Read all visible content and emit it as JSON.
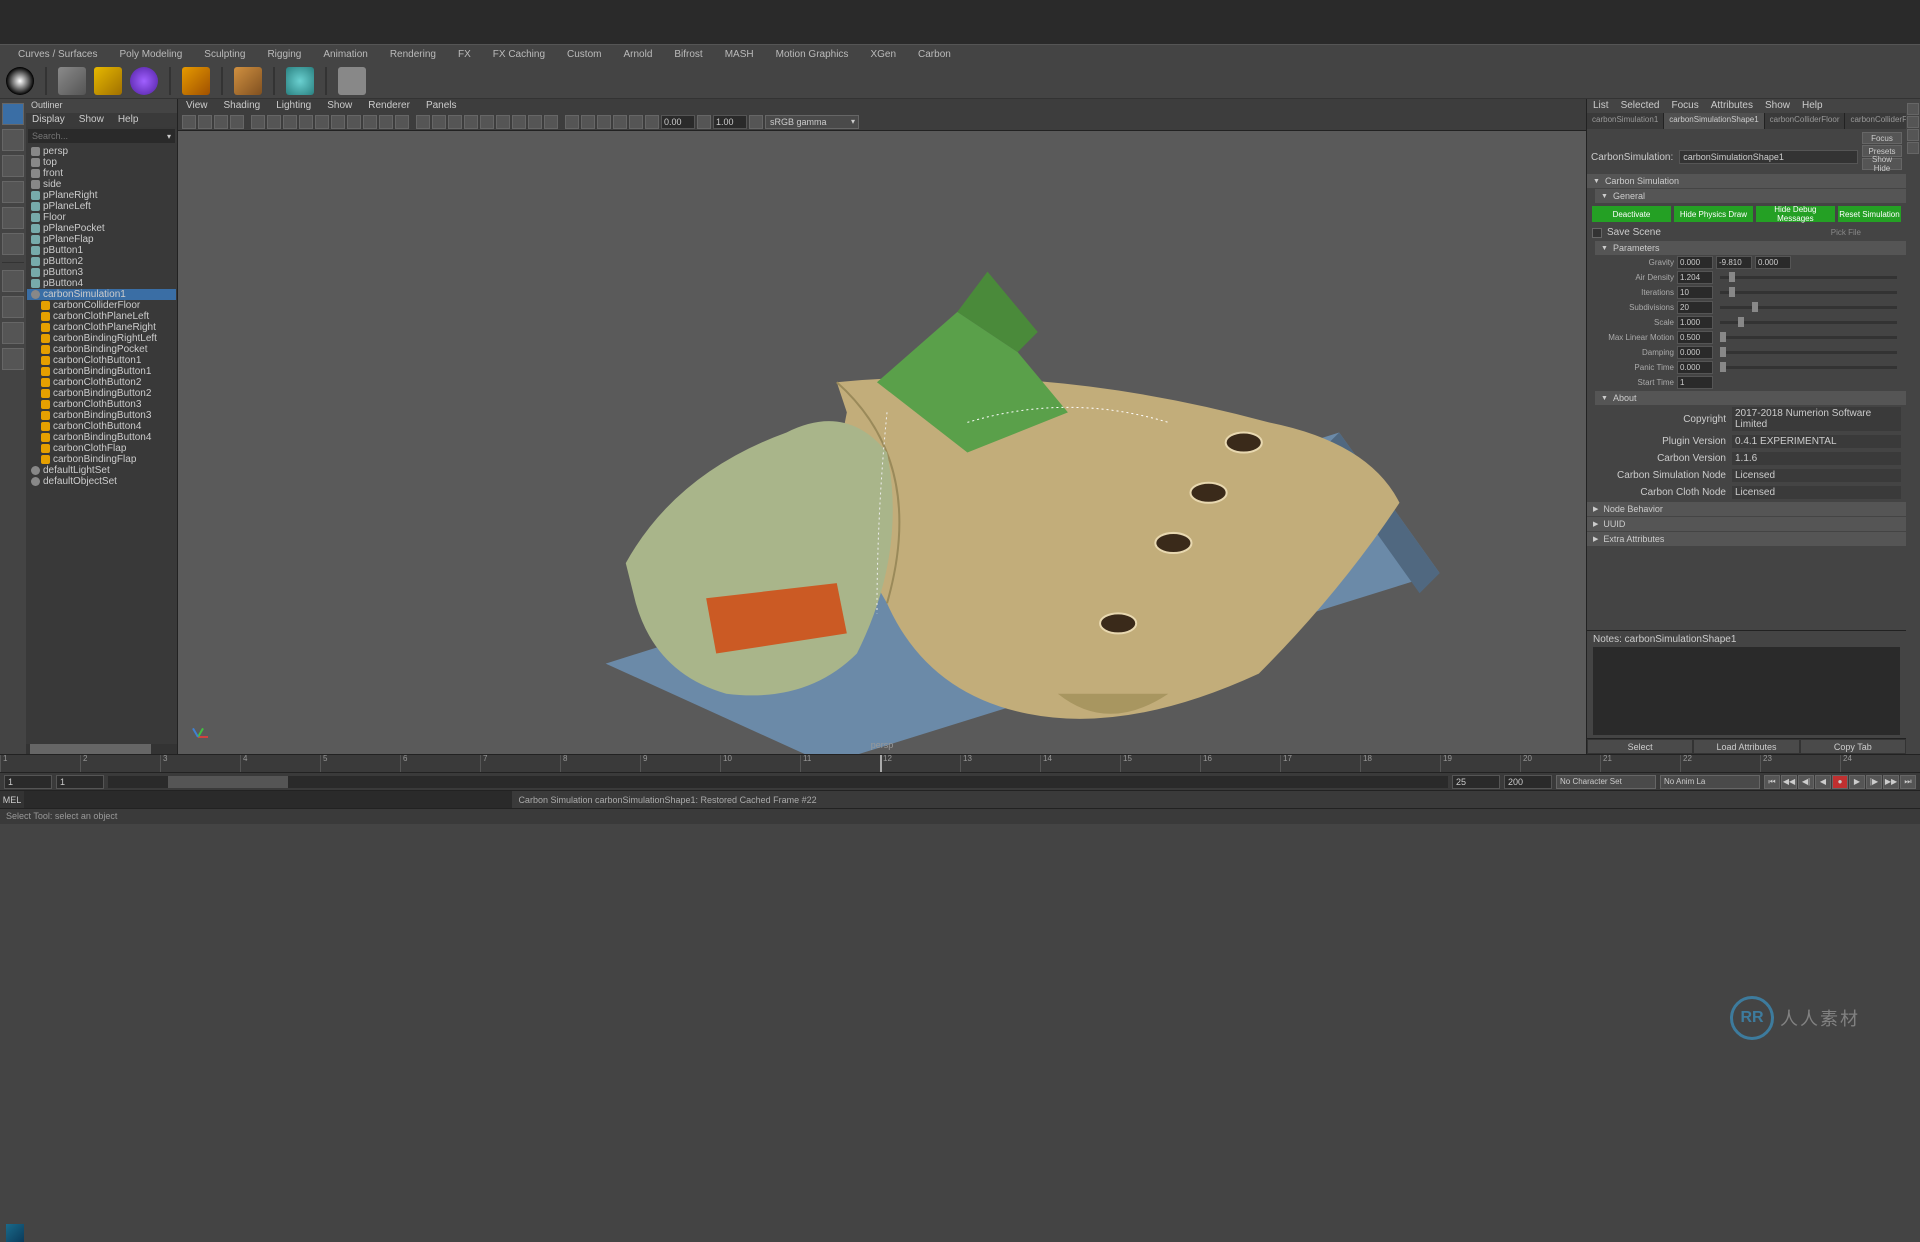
{
  "menubar": [
    "Curves / Surfaces",
    "Poly Modeling",
    "Sculpting",
    "Rigging",
    "Animation",
    "Rendering",
    "FX",
    "FX Caching",
    "Custom",
    "Arnold",
    "Bifrost",
    "MASH",
    "Motion Graphics",
    "XGen",
    "Carbon"
  ],
  "outliner": {
    "title": "Outliner",
    "menu": [
      "Display",
      "Show",
      "Help"
    ],
    "search_placeholder": "Search...",
    "items": [
      {
        "label": "persp",
        "dim": true,
        "ico": "cam"
      },
      {
        "label": "top",
        "dim": true,
        "ico": "cam"
      },
      {
        "label": "front",
        "dim": true,
        "ico": "cam"
      },
      {
        "label": "side",
        "dim": true,
        "ico": "cam"
      },
      {
        "label": "pPlaneRight",
        "dim": true,
        "ico": "mesh"
      },
      {
        "label": "pPlaneLeft",
        "dim": true,
        "ico": "mesh"
      },
      {
        "label": "Floor",
        "dim": true,
        "ico": "mesh"
      },
      {
        "label": "pPlanePocket",
        "dim": true,
        "ico": "mesh"
      },
      {
        "label": "pPlaneFlap",
        "dim": true,
        "ico": "mesh"
      },
      {
        "label": "pButton1",
        "dim": true,
        "ico": "mesh"
      },
      {
        "label": "pButton2",
        "dim": true,
        "ico": "mesh"
      },
      {
        "label": "pButton3",
        "dim": true,
        "ico": "mesh"
      },
      {
        "label": "pButton4",
        "dim": true,
        "ico": "mesh"
      },
      {
        "label": "carbonSimulation1",
        "sel": true,
        "ico": "node"
      },
      {
        "label": "carbonColliderFloor",
        "ind": 1,
        "ico": "sim"
      },
      {
        "label": "carbonClothPlaneLeft",
        "ind": 1,
        "ico": "sim"
      },
      {
        "label": "carbonClothPlaneRight",
        "ind": 1,
        "ico": "sim"
      },
      {
        "label": "carbonBindingRightLeft",
        "ind": 1,
        "ico": "sim"
      },
      {
        "label": "carbonBindingPocket",
        "ind": 1,
        "ico": "sim"
      },
      {
        "label": "carbonClothButton1",
        "ind": 1,
        "ico": "sim"
      },
      {
        "label": "carbonBindingButton1",
        "ind": 1,
        "ico": "sim"
      },
      {
        "label": "carbonClothButton2",
        "ind": 1,
        "ico": "sim"
      },
      {
        "label": "carbonBindingButton2",
        "ind": 1,
        "ico": "sim"
      },
      {
        "label": "carbonClothButton3",
        "ind": 1,
        "ico": "sim"
      },
      {
        "label": "carbonBindingButton3",
        "ind": 1,
        "ico": "sim"
      },
      {
        "label": "carbonClothButton4",
        "ind": 1,
        "ico": "sim"
      },
      {
        "label": "carbonBindingButton4",
        "ind": 1,
        "ico": "sim"
      },
      {
        "label": "carbonClothFlap",
        "ind": 1,
        "ico": "sim"
      },
      {
        "label": "carbonBindingFlap",
        "ind": 1,
        "ico": "sim"
      },
      {
        "label": "defaultLightSet",
        "ico": "node"
      },
      {
        "label": "defaultObjectSet",
        "ico": "node"
      }
    ]
  },
  "viewport": {
    "menu": [
      "View",
      "Shading",
      "Lighting",
      "Show",
      "Renderer",
      "Panels"
    ],
    "near_clip": "0.00",
    "gamma_val": "1.00",
    "colorspace": "sRGB gamma",
    "label": "persp"
  },
  "attribute_editor": {
    "menu": [
      "List",
      "Selected",
      "Focus",
      "Attributes",
      "Show",
      "Help"
    ],
    "tabs": [
      "carbonSimulation1",
      "carbonSimulationShape1",
      "carbonColliderFloor",
      "carbonColliderFloorSh"
    ],
    "active_tab": 1,
    "side_btns": [
      "Focus",
      "Presets",
      "Show  Hide"
    ],
    "node_label": "CarbonSimulation:",
    "node_name": "carbonSimulationShape1",
    "sections": {
      "sim": "Carbon Simulation",
      "general": "General",
      "params": "Parameters",
      "about": "About",
      "node_behavior": "Node Behavior",
      "uuid": "UUID",
      "extra": "Extra Attributes"
    },
    "buttons": {
      "deactivate": "Deactivate",
      "hide_physics": "Hide Physics Draw",
      "hide_debug": "Hide Debug Messages",
      "reset": "Reset Simulation"
    },
    "save_scene": "Save Scene",
    "pick_file": "Pick File",
    "params": [
      {
        "label": "Gravity",
        "vals": [
          "0.000",
          "-9.810",
          "0.000"
        ],
        "slider": null
      },
      {
        "label": "Air Density",
        "vals": [
          "1.204"
        ],
        "slider": 5
      },
      {
        "label": "Iterations",
        "vals": [
          "10"
        ],
        "slider": 5
      },
      {
        "label": "Subdivisions",
        "vals": [
          "20"
        ],
        "slider": 18
      },
      {
        "label": "Scale",
        "vals": [
          "1.000"
        ],
        "slider": 10
      },
      {
        "label": "Max Linear Motion",
        "vals": [
          "0.500"
        ],
        "slider": 0
      },
      {
        "label": "Damping",
        "vals": [
          "0.000"
        ],
        "slider": 0
      },
      {
        "label": "Panic Time",
        "vals": [
          "0.000"
        ],
        "slider": 0
      },
      {
        "label": "Start Time",
        "vals": [
          "1"
        ],
        "slider": null
      }
    ],
    "about": [
      {
        "label": "Copyright",
        "val": "2017-2018 Numerion Software Limited"
      },
      {
        "label": "Plugin Version",
        "val": "0.4.1 EXPERIMENTAL"
      },
      {
        "label": "Carbon Version",
        "val": "1.1.6"
      },
      {
        "label": "Carbon Simulation Node",
        "val": "Licensed"
      },
      {
        "label": "Carbon Cloth Node",
        "val": "Licensed"
      }
    ],
    "notes_label": "Notes: carbonSimulationShape1",
    "bottom": [
      "Select",
      "Load Attributes",
      "Copy Tab"
    ]
  },
  "timeline": {
    "ticks": [
      "1",
      "2",
      "3",
      "4",
      "5",
      "6",
      "7",
      "8",
      "9",
      "10",
      "11",
      "12",
      "13",
      "14",
      "15",
      "16",
      "17",
      "18",
      "19",
      "20",
      "21",
      "22",
      "23",
      "24"
    ],
    "current": 12
  },
  "range": {
    "start_outer": "1",
    "start_inner": "1",
    "end_inner": "25",
    "end_outer": "200",
    "charset": "No Character Set",
    "anim": "No Anim La"
  },
  "cmd": {
    "mode": "MEL",
    "output": "Carbon Simulation carbonSimulationShape1: Restored Cached Frame #22"
  },
  "helpline": "Select Tool: select an object",
  "watermark": "人人素材"
}
